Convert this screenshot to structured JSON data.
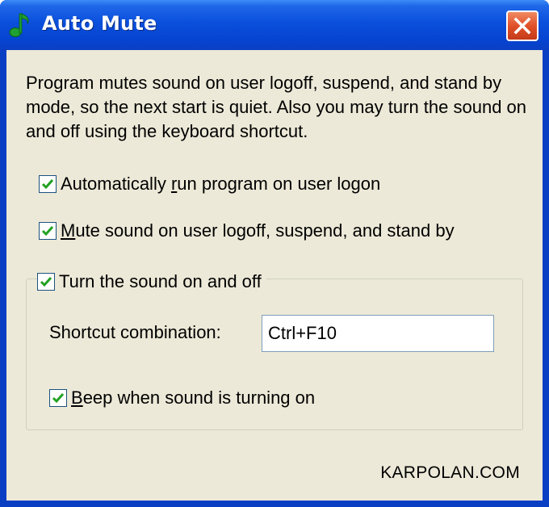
{
  "window": {
    "title": "Auto Mute",
    "icon": "music-note-icon",
    "close_icon": "close-icon"
  },
  "description": "Program mutes sound on user logoff, suspend, and stand by mode, so the next start is quiet. Also you may turn the sound on and off using the keyboard shortcut.",
  "options": {
    "autorun": {
      "before": "Automatically ",
      "accel": "r",
      "after": "un program on user logon",
      "checked": true
    },
    "mute": {
      "before": "",
      "accel": "M",
      "after": "ute sound on user logoff, suspend, and stand by",
      "checked": true
    }
  },
  "group": {
    "toggle_label": "Turn the sound on and off",
    "toggle_checked": true,
    "shortcut_label": "Shortcut combination:",
    "shortcut_value": "Ctrl+F10",
    "beep": {
      "before": "",
      "accel": "B",
      "after": "eep when sound is turning on",
      "checked": true
    }
  },
  "footer": "KARPOLAN.COM",
  "colors": {
    "titlebar": "#0a4fdc",
    "client_bg": "#ece9d8",
    "checkmark": "#21a121",
    "close_button": "#e0512a"
  }
}
